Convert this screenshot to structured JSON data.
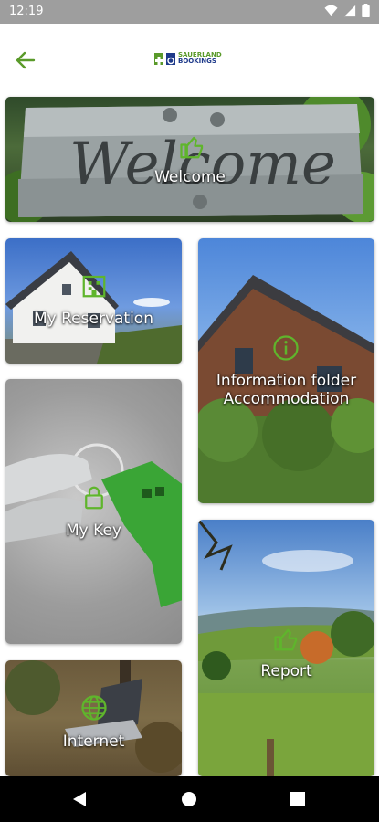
{
  "status_bar": {
    "time": "12:19",
    "icons": [
      "wifi-icon",
      "signal-icon",
      "battery-icon"
    ]
  },
  "header": {
    "back_icon": "arrow-left-icon",
    "logo_line1": "SAUERLAND",
    "logo_line2": "BOOKINGS"
  },
  "tiles": {
    "welcome": {
      "label": "Welcome",
      "icon": "thumbs-up-icon"
    },
    "my_reservation": {
      "label": "My Reservation",
      "icon": "building-icon"
    },
    "information_folder": {
      "label": "Information folder Accommodation",
      "icon": "info-icon"
    },
    "my_key": {
      "label": "My Key",
      "icon": "lock-icon"
    },
    "report": {
      "label": "Report",
      "icon": "thumbs-up-icon"
    },
    "internet": {
      "label": "Internet",
      "icon": "globe-icon"
    }
  },
  "nav_bar": {
    "back": "triangle-back-icon",
    "home": "circle-home-icon",
    "recents": "square-recents-icon"
  },
  "colors": {
    "accent_green": "#5fb52c",
    "brand_blue": "#1e3a8a",
    "status_bar": "#9e9e9e"
  }
}
